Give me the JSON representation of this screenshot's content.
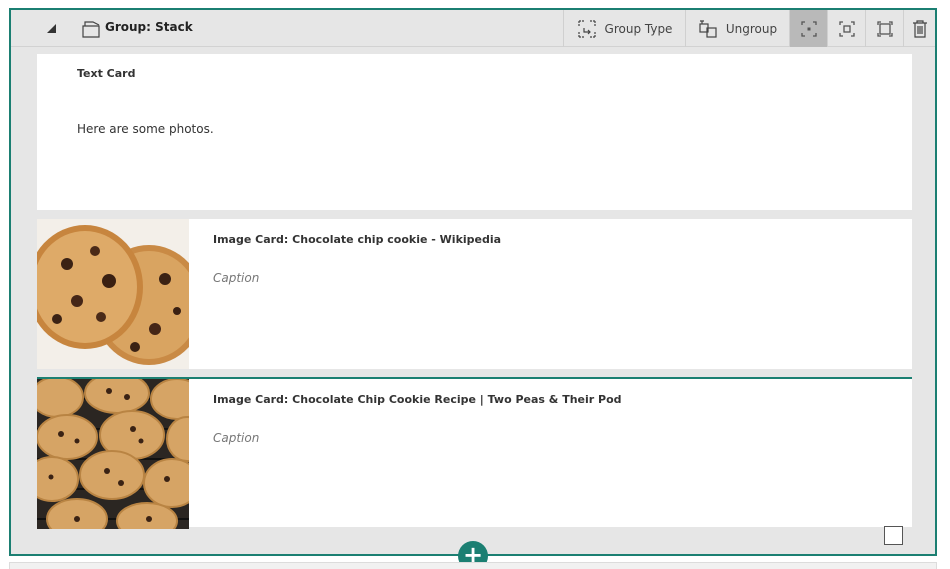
{
  "group": {
    "title": "Group: Stack",
    "toolbar": {
      "group_type_label": "Group Type",
      "ungroup_label": "Ungroup"
    }
  },
  "cards": {
    "text_card": {
      "title": "Text Card",
      "body": "Here are some photos."
    },
    "image_cards": [
      {
        "title": "Image Card: Chocolate chip cookie - Wikipedia",
        "caption_placeholder": "Caption"
      },
      {
        "title": "Image Card: Chocolate Chip Cookie Recipe | Two Peas & Their Pod",
        "caption_placeholder": "Caption"
      }
    ]
  },
  "icons": {
    "collapse": "triangle-collapse-icon",
    "group": "group-stack-icon",
    "group_type": "group-type-icon",
    "ungroup": "ungroup-icon",
    "size_small": "size-small-icon",
    "size_medium": "size-medium-icon",
    "size_large": "size-large-icon",
    "delete": "trash-icon",
    "add": "plus-icon"
  },
  "colors": {
    "accent": "#1b7f72",
    "header_bg": "#e6e6e6",
    "active_button": "#b9b9b9"
  }
}
